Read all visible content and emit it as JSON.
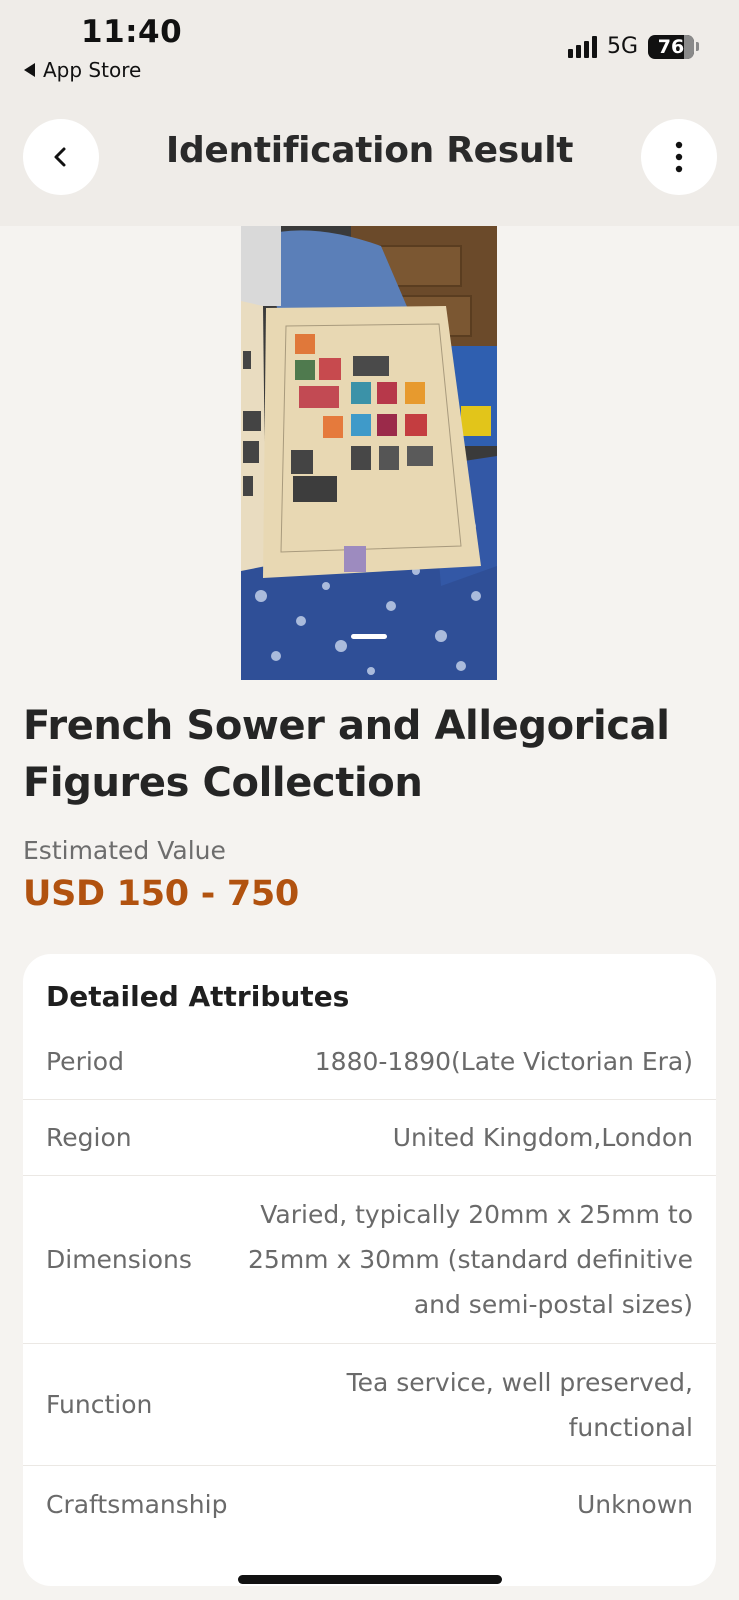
{
  "status_bar": {
    "time": "11:40",
    "back_app": "App Store",
    "network": "5G",
    "battery": "76"
  },
  "header": {
    "title": "Identification Result",
    "back_icon": "chevron-left-icon",
    "more_icon": "more-vertical-icon"
  },
  "item": {
    "title": "French Sower and Allegorical Figures Collection",
    "value_label": "Estimated Value",
    "value_range": "USD 150 - 750"
  },
  "attributes": {
    "heading": "Detailed Attributes",
    "rows": [
      {
        "label": "Period",
        "value": "1880-1890(Late Victorian Era)"
      },
      {
        "label": "Region",
        "value": "United Kingdom,London"
      },
      {
        "label": "Dimensions",
        "value": "Varied, typically 20mm x 25mm to 25mm x 30mm (standard definitive and semi-postal sizes)"
      },
      {
        "label": "Function",
        "value": "Tea service, well preserved, functional"
      },
      {
        "label": "Craftsmanship",
        "value": "Unknown"
      }
    ]
  },
  "colors": {
    "accent": "#b1520f",
    "background": "#f5f3f0",
    "header_bg": "#efece8",
    "card_bg": "#ffffff"
  }
}
